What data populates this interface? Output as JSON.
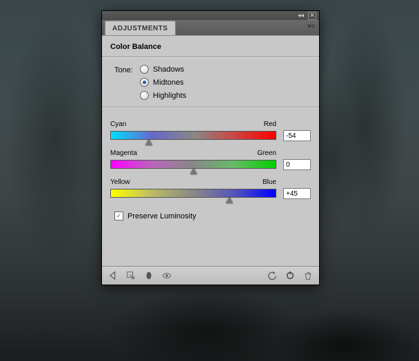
{
  "panel": {
    "tab": "ADJUSTMENTS",
    "title": "Color Balance",
    "tone_label": "Tone:",
    "tones": {
      "shadows": "Shadows",
      "midtones": "Midtones",
      "highlights": "Highlights",
      "selected": "midtones"
    },
    "sliders": {
      "cyan_red": {
        "left": "Cyan",
        "right": "Red",
        "value": "-54",
        "pos": 23
      },
      "magenta_grn": {
        "left": "Magenta",
        "right": "Green",
        "value": "0",
        "pos": 50
      },
      "yellow_blue": {
        "left": "Yellow",
        "right": "Blue",
        "value": "+45",
        "pos": 72
      }
    },
    "preserve": {
      "label": "Preserve Luminosity",
      "checked": true
    }
  }
}
